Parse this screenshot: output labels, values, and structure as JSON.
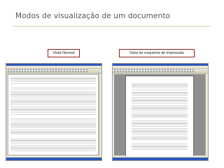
{
  "slide": {
    "title": "Modos de visualização de um documento",
    "labels": {
      "normal": "Vista Normal",
      "print": "Vista de esquema de impressão"
    }
  },
  "colors": {
    "title": "#555555",
    "label_border": "#8a1f1f",
    "window_titlebar": "#2f56b8",
    "print_gray": "#8f8f8f"
  }
}
